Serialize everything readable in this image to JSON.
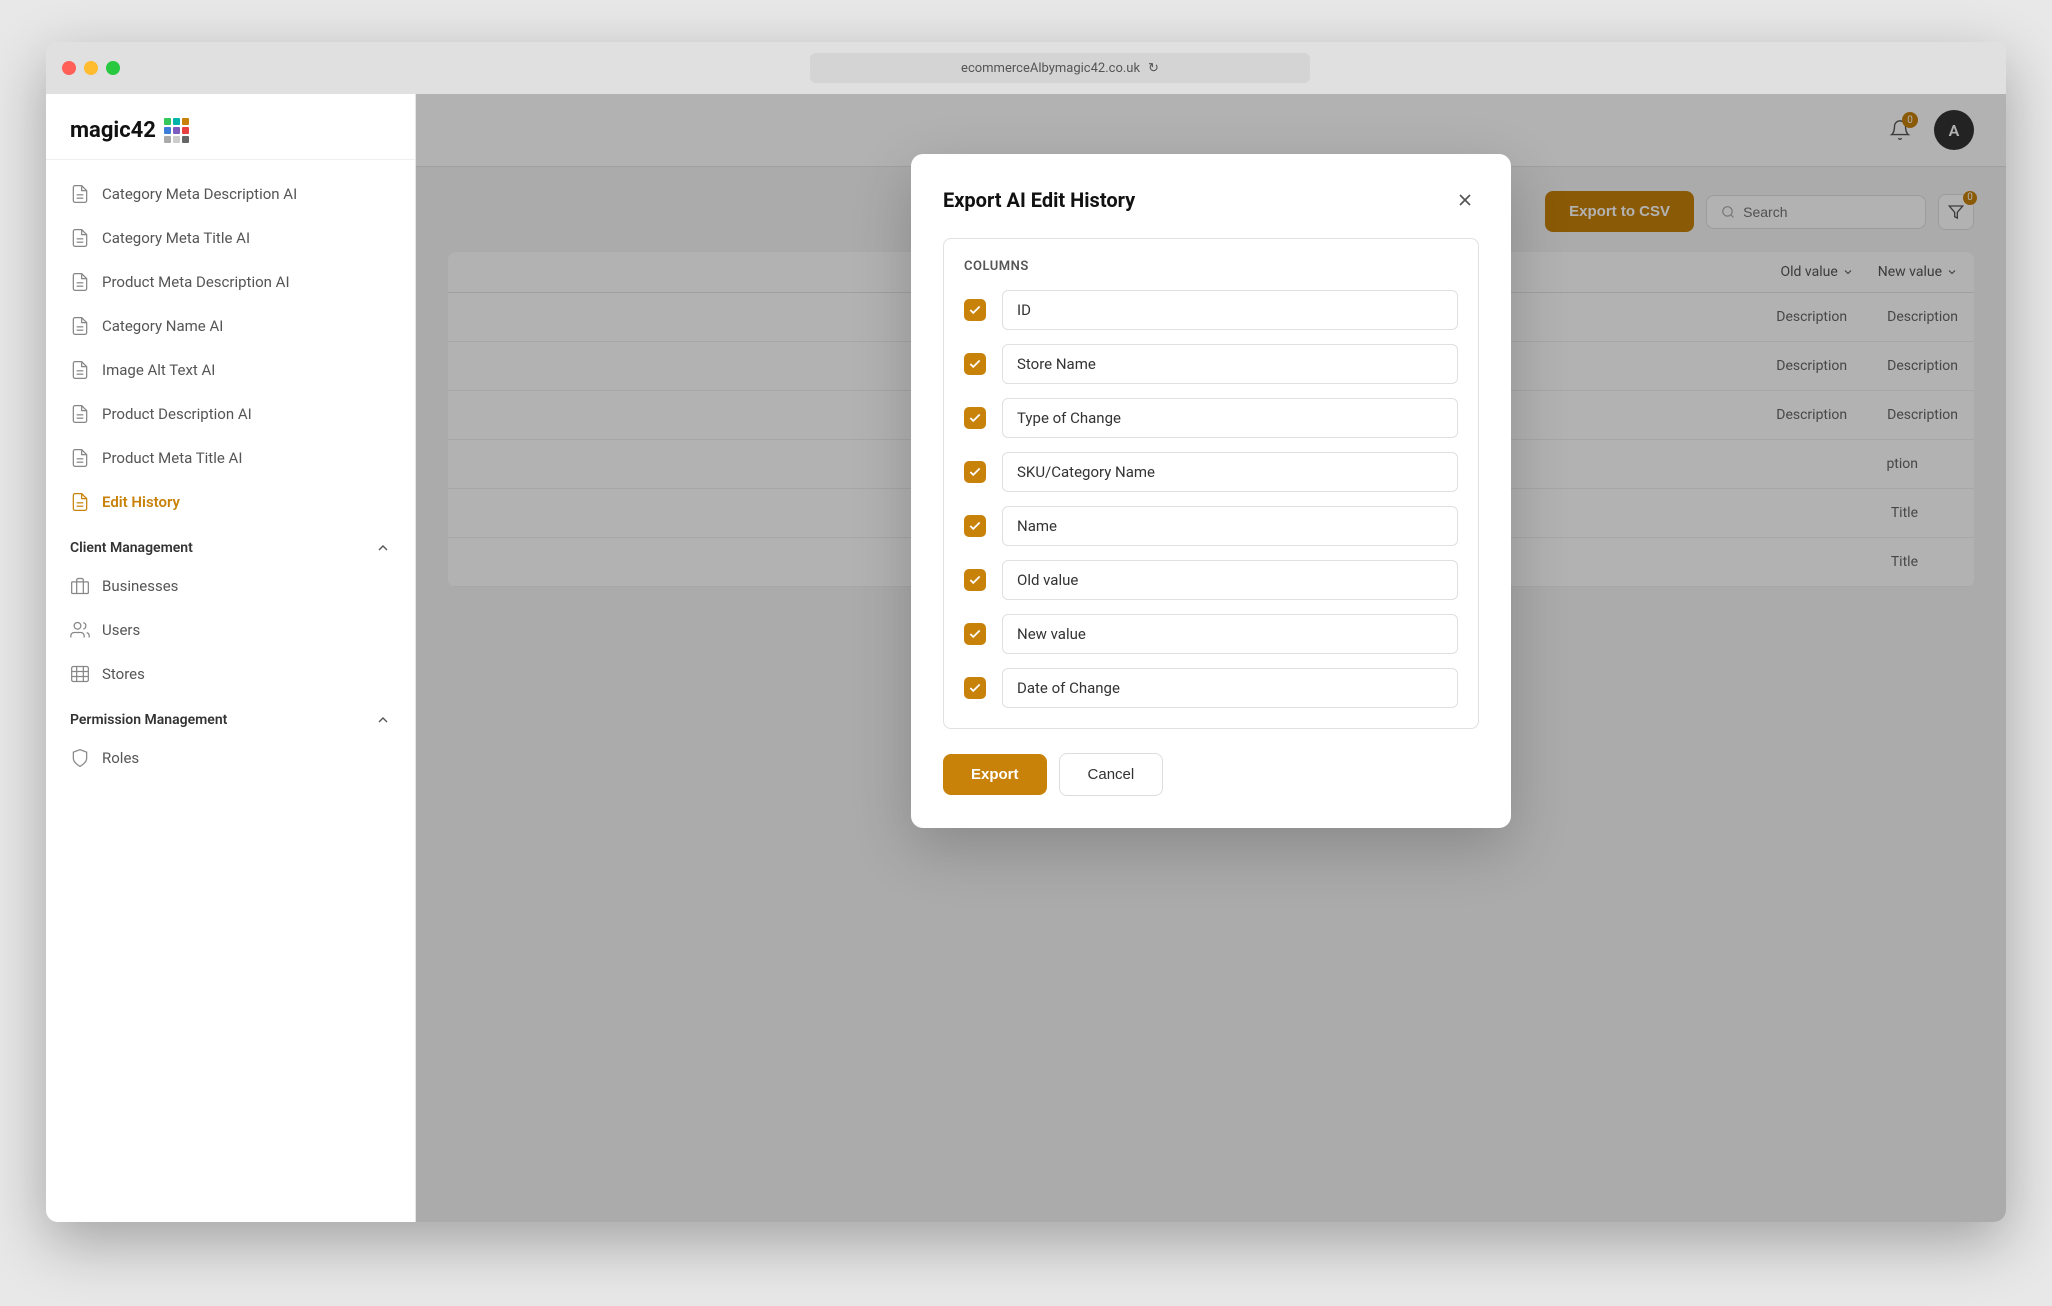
{
  "browser": {
    "url": "ecommerceAlbymagic42.co.uk",
    "reload_label": "↻"
  },
  "logo": {
    "text": "magic42",
    "dots_colors": [
      "#34c759",
      "#00b4aa",
      "#c8820a",
      "#3b7dd8",
      "#7c5cbf",
      "#e84040",
      "#aaa",
      "#ccc",
      "#666"
    ]
  },
  "sidebar": {
    "nav_items": [
      {
        "label": "Category Meta Description AI",
        "icon": "file",
        "active": false
      },
      {
        "label": "Category Meta Title AI",
        "icon": "file",
        "active": false
      },
      {
        "label": "Product Meta Description AI",
        "icon": "file",
        "active": false
      },
      {
        "label": "Category Name AI",
        "icon": "file",
        "active": false
      },
      {
        "label": "Image Alt Text AI",
        "icon": "file",
        "active": false
      },
      {
        "label": "Product Description AI",
        "icon": "file",
        "active": false
      },
      {
        "label": "Product Meta Title AI",
        "icon": "file",
        "active": false
      },
      {
        "label": "Edit History",
        "icon": "file",
        "active": true
      }
    ],
    "sections": [
      {
        "label": "Client Management",
        "expanded": true,
        "items": [
          {
            "label": "Businesses",
            "icon": "building"
          },
          {
            "label": "Users",
            "icon": "users"
          },
          {
            "label": "Stores",
            "icon": "store"
          }
        ]
      },
      {
        "label": "Permission Management",
        "expanded": true,
        "items": [
          {
            "label": "Roles",
            "icon": "shield"
          }
        ]
      }
    ]
  },
  "header": {
    "notification_count": "0",
    "avatar_letter": "A"
  },
  "toolbar": {
    "export_csv_label": "Export to CSV",
    "search_placeholder": "Search",
    "filter_badge": "0"
  },
  "table": {
    "columns": [
      {
        "label": "Old value",
        "sortable": true
      },
      {
        "label": "New value",
        "sortable": true
      }
    ],
    "rows": [
      {
        "right_vals": [
          "Description",
          "Description"
        ]
      },
      {
        "right_vals": [
          "Description",
          "Description"
        ]
      },
      {
        "right_vals": [
          "Description",
          "Description"
        ]
      },
      {
        "right_vals": [
          "ption",
          ""
        ]
      },
      {
        "right_vals": [
          "Title",
          ""
        ]
      },
      {
        "right_vals": [
          "Title",
          ""
        ]
      }
    ]
  },
  "modal": {
    "title": "Export AI Edit History",
    "section_label": "Columns",
    "columns": [
      {
        "label": "ID",
        "checked": true
      },
      {
        "label": "Store Name",
        "checked": true
      },
      {
        "label": "Type of Change",
        "checked": true
      },
      {
        "label": "SKU/Category Name",
        "checked": true
      },
      {
        "label": "Name",
        "checked": true
      },
      {
        "label": "Old value",
        "checked": true
      },
      {
        "label": "New value",
        "checked": true
      },
      {
        "label": "Date of Change",
        "checked": true
      }
    ],
    "export_label": "Export",
    "cancel_label": "Cancel"
  }
}
